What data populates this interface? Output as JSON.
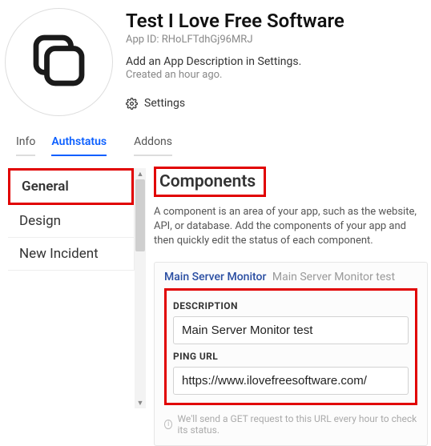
{
  "header": {
    "title": "Test I Love Free Software",
    "app_id_line": "App ID: RHoLFTdhGj96MRJ",
    "description_prompt": "Add an App Description in Settings.",
    "created": "Created an hour ago.",
    "settings_label": "Settings"
  },
  "tabs": [
    {
      "label": "Info",
      "active": false
    },
    {
      "label": "Authstatus",
      "active": true
    },
    {
      "label": "Addons",
      "active": false
    }
  ],
  "sidebar": {
    "items": [
      {
        "label": "General",
        "active": true
      },
      {
        "label": "Design",
        "active": false
      },
      {
        "label": "New Incident",
        "active": false
      }
    ]
  },
  "main": {
    "section_title": "Components",
    "section_desc": "A component is an area of your app, such as the website, API, or database. Add the components of your app and then quickly edit the status of each component.",
    "component": {
      "name": "Main Server Monitor",
      "subtitle": "Main Server Monitor test",
      "fields": {
        "description_label": "DESCRIPTION",
        "description_value": "Main Server Monitor test",
        "pingurl_label": "PING URL",
        "pingurl_value": "https://www.ilovefreesoftware.com/"
      }
    },
    "footer_hint": "We'll send a GET request to this URL every hour to check its status."
  }
}
